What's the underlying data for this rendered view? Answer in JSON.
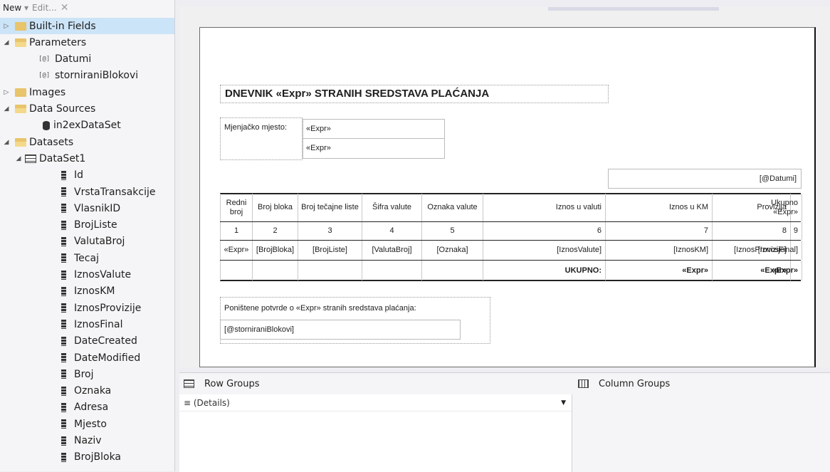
{
  "toolbar": {
    "new_label": "New",
    "new_arrow": "▾",
    "edit_label": "Edit...",
    "delete_glyph": "✕"
  },
  "tree": {
    "builtin_fields": "Built-in Fields",
    "parameters": "Parameters",
    "param_1": "Datumi",
    "param_2": "storniraniBlokovi",
    "param_badge": "[@]",
    "images": "Images",
    "data_sources": "Data Sources",
    "datasource_1": "in2exDataSet",
    "datasets": "Datasets",
    "dataset_1": "DataSet1",
    "fields": [
      "Id",
      "VrstaTransakcije",
      "VlasnikID",
      "BrojListe",
      "ValutaBroj",
      "Tecaj",
      "IznosValute",
      "IznosKM",
      "IznosProvizije",
      "IznosFinal",
      "DateCreated",
      "DateModified",
      "Broj",
      "Oznaka",
      "Adresa",
      "Mjesto",
      "Naziv",
      "BrojBloka"
    ],
    "expand_glyph": "▷",
    "collapse_glyph": "◢"
  },
  "report": {
    "title": "DNEVNIK «Expr» STRANIH SREDSTAVA PLAĆANJA",
    "mjenjacko_label": "Mjenjačko mjesto:",
    "expr_1": "«Expr»",
    "expr_2": "«Expr»",
    "datumi_param": "[@Datumi]",
    "table": {
      "headers": [
        "Redni broj",
        "Broj bloka",
        "Broj tečajne liste",
        "Šifra valute",
        "Oznaka valute",
        "Iznos u valuti",
        "Iznos u KM",
        "Provizija",
        "Ukupno «Expr»"
      ],
      "numbers": [
        "1",
        "2",
        "3",
        "4",
        "5",
        "6",
        "7",
        "8",
        "9"
      ],
      "details": [
        "«Expr»",
        "[BrojBloka]",
        "[BrojListe]",
        "[ValutaBroj]",
        "[Oznaka]",
        "[IznosValute]",
        "[IznosKM]",
        "[IznosProvizije]",
        "[IznosFinal]"
      ],
      "totals": [
        "",
        "",
        "",
        "",
        "",
        "UKUPNO:",
        "«Expr»",
        "«Expr»",
        "«Expr»"
      ]
    },
    "ponistene_label": "Poništene potvrde o «Expr» stranih sredstava plaćanja:",
    "stornirani_param": "[@storniraniBlokovi]"
  },
  "grouping": {
    "row_groups_label": "Row Groups",
    "column_groups_label": "Column Groups",
    "details_label": "≡ (Details)",
    "dropdown_glyph": "▼"
  }
}
